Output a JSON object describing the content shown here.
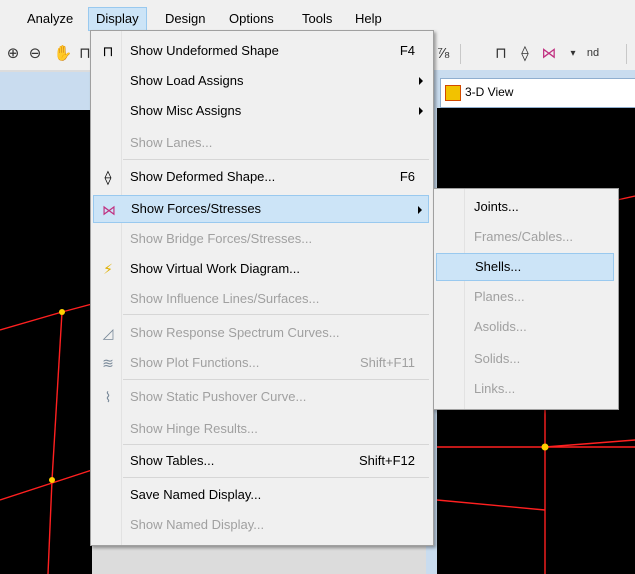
{
  "menubar": {
    "items": [
      {
        "label": "Analyze"
      },
      {
        "label": "Display",
        "active": true
      },
      {
        "label": "Design"
      },
      {
        "label": "Options"
      },
      {
        "label": "Tools"
      },
      {
        "label": "Help"
      }
    ]
  },
  "toolbar": {
    "right_text": "nd"
  },
  "view": {
    "title": "3-D View"
  },
  "display_menu": {
    "items": [
      {
        "label": "Show Undeformed Shape",
        "shortcut": "F4",
        "enabled": true
      },
      {
        "label": "Show Load Assigns",
        "submenu": true,
        "enabled": true
      },
      {
        "label": "Show Misc Assigns",
        "submenu": true,
        "enabled": true
      },
      {
        "label": "Show Lanes...",
        "enabled": false
      },
      {
        "label": "Show  Deformed Shape...",
        "shortcut": "F6",
        "enabled": true
      },
      {
        "label": "Show Forces/Stresses",
        "submenu": true,
        "enabled": true,
        "highlighted": true
      },
      {
        "label": "Show Bridge Forces/Stresses...",
        "enabled": false
      },
      {
        "label": "Show Virtual Work Diagram...",
        "enabled": true
      },
      {
        "label": "Show Influence Lines/Surfaces...",
        "enabled": false
      },
      {
        "label": "Show Response Spectrum Curves...",
        "enabled": false
      },
      {
        "label": "Show Plot Functions...",
        "shortcut": "Shift+F11",
        "enabled": false
      },
      {
        "label": "Show Static Pushover Curve...",
        "enabled": false
      },
      {
        "label": "Show Hinge Results...",
        "enabled": false
      },
      {
        "label": "Show Tables...",
        "shortcut": "Shift+F12",
        "enabled": true
      },
      {
        "label": "Save Named Display...",
        "enabled": true
      },
      {
        "label": "Show Named Display...",
        "enabled": false
      }
    ]
  },
  "forces_submenu": {
    "items": [
      {
        "label": "Joints...",
        "enabled": true
      },
      {
        "label": "Frames/Cables...",
        "enabled": false
      },
      {
        "label": "Shells...",
        "enabled": true,
        "highlighted": true
      },
      {
        "label": "Planes...",
        "enabled": false
      },
      {
        "label": "Asolids...",
        "enabled": false
      },
      {
        "label": "Solids...",
        "enabled": false
      },
      {
        "label": "Links...",
        "enabled": false
      }
    ]
  },
  "colors": {
    "highlight_bg": "#cce4f7",
    "highlight_border": "#99c9ef",
    "disabled_text": "#a0a0a0",
    "canvas": "#000000",
    "frame_line": "#ff2020",
    "joint": "#ffd000"
  },
  "icons": {
    "deformed_shape": "deformed-shape-icon",
    "forces": "forces-stresses-icon",
    "virtual_work": "lightning-icon",
    "response_spectrum": "response-spectrum-icon",
    "plot_functions": "plot-functions-icon",
    "pushover": "pushover-curve-icon"
  }
}
